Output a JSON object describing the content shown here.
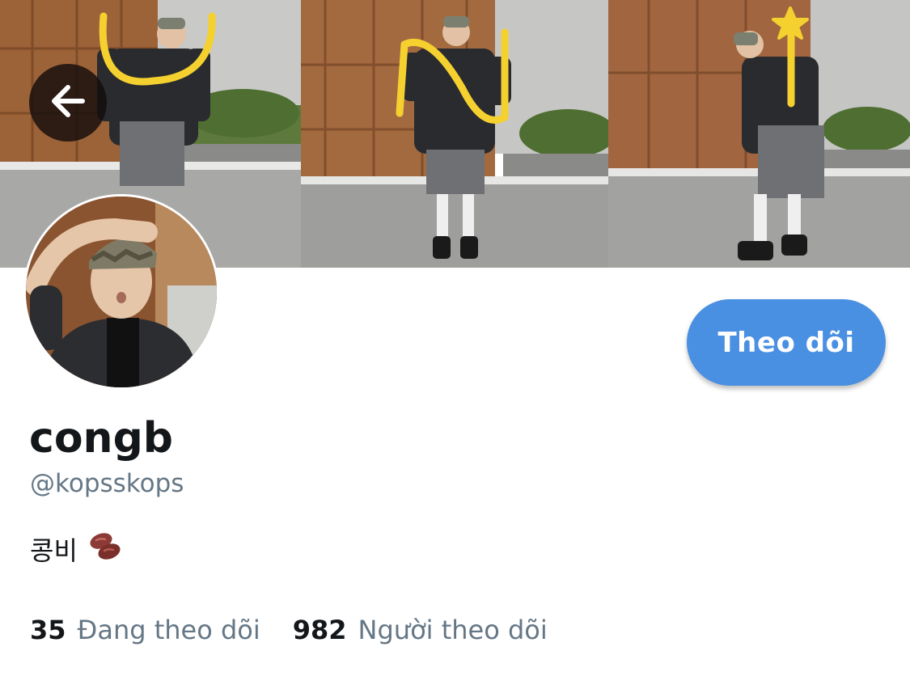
{
  "profile": {
    "display_name": "congb",
    "handle": "@kopsskops",
    "bio_text": "콩비",
    "bio_emoji": "beans-emoji"
  },
  "stats": {
    "following_count": "35",
    "following_label": "Đang theo dõi",
    "followers_count": "982",
    "followers_label": "Người theo dõi"
  },
  "actions": {
    "follow_label": "Theo dõi"
  },
  "icons": {
    "back": "arrow-left-icon"
  },
  "colors": {
    "accent": "#4a90e2",
    "text_primary": "#14171a",
    "text_secondary": "#657786",
    "doodle": "#f5d130"
  }
}
